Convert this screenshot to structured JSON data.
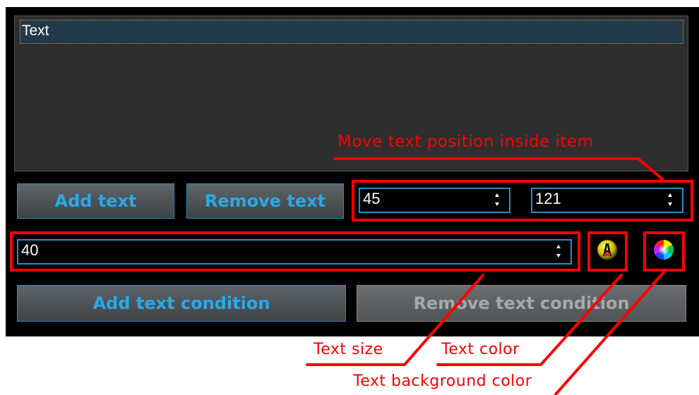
{
  "list": {
    "items": [
      "Text"
    ]
  },
  "buttons": {
    "add_text": "Add text",
    "remove_text": "Remove text",
    "add_condition": "Add text condition",
    "remove_condition": "Remove text condition"
  },
  "position": {
    "x": "45",
    "y": "121"
  },
  "text_size": {
    "value": "40"
  },
  "icons": {
    "text_color": "text-color-icon",
    "background_color": "color-wheel-icon"
  },
  "annotations": {
    "move_position": "Move text position inside item",
    "text_size": "Text size",
    "text_color": "Text color",
    "background_color": "Text background color"
  },
  "colors": {
    "panel_bg": "#000000",
    "button_text": "#29a9e8",
    "border_accent": "#1e90c8",
    "annotation": "#ff0000"
  }
}
